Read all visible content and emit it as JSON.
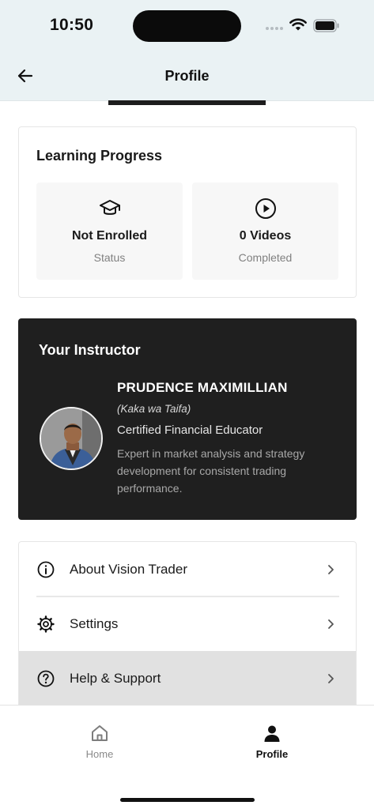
{
  "status_bar": {
    "time": "10:50"
  },
  "header": {
    "title": "Profile"
  },
  "learning_progress": {
    "title": "Learning Progress",
    "stats": [
      {
        "icon": "graduation-cap-icon",
        "value": "Not Enrolled",
        "label": "Status"
      },
      {
        "icon": "play-circle-icon",
        "value": "0 Videos",
        "label": "Completed"
      }
    ]
  },
  "instructor": {
    "section_title": "Your Instructor",
    "name": "PRUDENCE MAXIMILLIAN",
    "nickname": "(Kaka wa Taifa)",
    "role": "Certified Financial Educator",
    "bio": "Expert in market analysis and strategy development for consistent trading performance."
  },
  "menu": {
    "items": [
      {
        "icon": "info-icon",
        "label": "About Vision Trader"
      },
      {
        "icon": "gear-icon",
        "label": "Settings"
      },
      {
        "icon": "help-icon",
        "label": "Help & Support"
      }
    ]
  },
  "bottom_nav": {
    "items": [
      {
        "icon": "home-icon",
        "label": "Home",
        "active": false
      },
      {
        "icon": "person-icon",
        "label": "Profile",
        "active": true
      }
    ]
  },
  "colors": {
    "header_bg": "#eaf2f4",
    "instructor_card_bg": "#1f1f1f",
    "highlight_row_bg": "#e1e1e1"
  }
}
